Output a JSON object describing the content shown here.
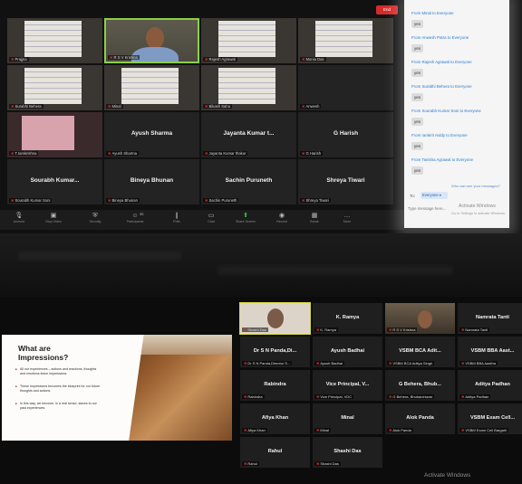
{
  "top_meeting": {
    "tiles": [
      {
        "name_display": "",
        "tag": "Prajjna",
        "kind": "paper"
      },
      {
        "name_display": "",
        "tag": "R S V Krishna",
        "kind": "video-man",
        "active": true
      },
      {
        "name_display": "",
        "tag": "Rajesh Agrawal",
        "kind": "paper"
      },
      {
        "name_display": "",
        "tag": "Monia Das",
        "kind": "paper"
      },
      {
        "name_display": "",
        "tag": "Surabhi Behera",
        "kind": "paper"
      },
      {
        "name_display": "",
        "tag": "Minal",
        "kind": "paper"
      },
      {
        "name_display": "",
        "tag": "Bikash Sahu",
        "kind": "paper"
      },
      {
        "name_display": "",
        "tag": "Anwesh",
        "kind": "blank"
      },
      {
        "name_display": "",
        "tag": "T.ramkrishna",
        "kind": "pink"
      },
      {
        "name_display": "Ayush Sharma",
        "tag": "Ayush Sharma",
        "kind": "name"
      },
      {
        "name_display": "Jayanta Kumar t...",
        "tag": "Jayanta Kumar thakur",
        "kind": "name"
      },
      {
        "name_display": "G Harish",
        "tag": "G Harish",
        "kind": "name"
      },
      {
        "name_display": "Sourabh Kumar...",
        "tag": "Sourabh Kumar Soni",
        "kind": "name"
      },
      {
        "name_display": "Bineya Bhunan",
        "tag": "Bineya Bhunan",
        "kind": "name"
      },
      {
        "name_display": "Sachin Puruneth",
        "tag": "Sachin Puruneth",
        "kind": "name"
      },
      {
        "name_display": "Shreya Tiwari",
        "tag": "Shreya Tiwari",
        "kind": "name"
      }
    ],
    "toolbar": [
      {
        "label": "Unmute",
        "icon": "mic-icon"
      },
      {
        "label": "Stop Video",
        "icon": "video-icon"
      },
      {
        "label": "Security",
        "icon": "shield-icon"
      },
      {
        "label": "Participants",
        "icon": "people-icon",
        "count": "35"
      },
      {
        "label": "Polls",
        "icon": "polls-icon"
      },
      {
        "label": "Chat",
        "icon": "chat-icon"
      },
      {
        "label": "Share Screen",
        "icon": "share-icon",
        "green": true
      },
      {
        "label": "Record",
        "icon": "record-icon"
      },
      {
        "label": "Break",
        "icon": "breakout-icon"
      },
      {
        "label": "More",
        "icon": "more-icon"
      }
    ],
    "end_label": "End"
  },
  "chat": {
    "messages": [
      {
        "header": "From Minal to Everyone",
        "text": "yes"
      },
      {
        "header": "From Anwesh Patra to Everyone",
        "text": "yes"
      },
      {
        "header": "From Rajesh Agrawal to Everyone",
        "text": "yes"
      },
      {
        "header": "From Surabhi Behera to Everyone",
        "text": "yes"
      },
      {
        "header": "From Sourabh Kumar Soni to Everyone",
        "text": "yes"
      },
      {
        "header": "From ramkrit reddy to Everyone",
        "text": "yes"
      },
      {
        "header": "From Tanisha Agrawal to Everyone",
        "text": "yes"
      }
    ],
    "who_can_see": "Who can see your messages?",
    "to_label": "To:",
    "to_value": "Everyone",
    "input_placeholder": "Type message here...",
    "activate_line1": "Activate Windows",
    "activate_line2": "Go to Settings to activate Windows."
  },
  "slide": {
    "title": "What are Impressions?",
    "bullets": [
      "All our experiences – actions and reactions, thoughts and emotions leave impressions.",
      "These impressions becomes the blueprint for our future thoughts and actions.",
      "In this way, we become, in a real sense, slaves to our past experiences."
    ]
  },
  "bottom_meeting": {
    "tiles": [
      {
        "name_display": "",
        "tag": "Shashi Das",
        "kind": "active"
      },
      {
        "name_display": "K. Ramya",
        "tag": "K. Ramya",
        "kind": "name"
      },
      {
        "name_display": "",
        "tag": "R S V Krishna",
        "kind": "cam2"
      },
      {
        "name_display": "Namrata Tanti",
        "tag": "Namrata Tanti",
        "kind": "name"
      },
      {
        "name_display": "Dr S N Panda,Di...",
        "tag": "Dr S N Panda,Director S...",
        "kind": "name"
      },
      {
        "name_display": "Ayush Badhai",
        "tag": "Ayush Badhai",
        "kind": "name"
      },
      {
        "name_display": "VSBM BCA Adit...",
        "tag": "VSBM BCA Aditya Singh",
        "kind": "name"
      },
      {
        "name_display": "VSBM BBA Aast...",
        "tag": "VSBM BBA Aastha",
        "kind": "name"
      },
      {
        "name_display": "Rabindra",
        "tag": "Rabindra",
        "kind": "name"
      },
      {
        "name_display": "Vice Principal, V...",
        "tag": "Vice Principal, VDC",
        "kind": "name"
      },
      {
        "name_display": "G Behera, Bhub...",
        "tag": "G Behera, Bhubaneswar",
        "kind": "name"
      },
      {
        "name_display": "Aditya Padhan",
        "tag": "Aditya Padhan",
        "kind": "name"
      },
      {
        "name_display": "Afiya Khan",
        "tag": "Afiya Khan",
        "kind": "name"
      },
      {
        "name_display": "Minal",
        "tag": "Minal",
        "kind": "name"
      },
      {
        "name_display": "Alok Panda",
        "tag": "Alok Panda",
        "kind": "name"
      },
      {
        "name_display": "VSBM Exam Cell...",
        "tag": "VSBM Exam Cell Bargarh",
        "kind": "name"
      },
      {
        "name_display": "Rahul",
        "tag": "Rahul",
        "kind": "name"
      },
      {
        "name_display": "Shashi Das",
        "tag": "Shashi Das",
        "kind": "name"
      }
    ],
    "activate": "Activate Windows"
  }
}
